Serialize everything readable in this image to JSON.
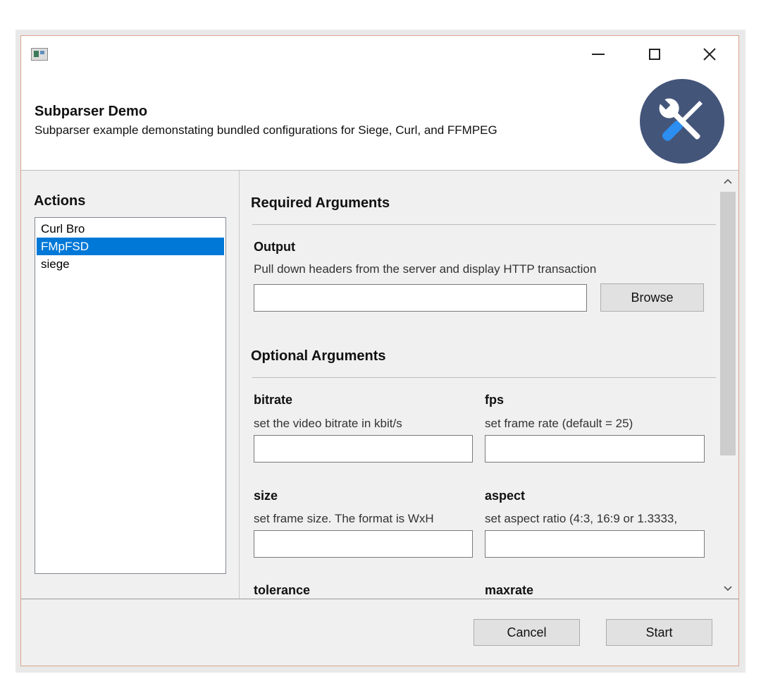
{
  "window": {
    "controls": {
      "minimize_icon": "minimize-icon",
      "maximize_icon": "maximize-icon",
      "close_icon": "close-icon"
    }
  },
  "header": {
    "title": "Subparser Demo",
    "description": "Subparser example demonstating bundled configurations for Siege, Curl, and FFMPEG",
    "logo_icon": "tools-icon",
    "logo_color": "#44557a"
  },
  "actions": {
    "title": "Actions",
    "items": [
      {
        "label": "Curl Bro",
        "selected": false
      },
      {
        "label": "FMpFSD",
        "selected": true
      },
      {
        "label": "siege",
        "selected": false
      }
    ],
    "selection_color": "#0078d7"
  },
  "required": {
    "title": "Required Arguments",
    "output": {
      "label": "Output",
      "help": "Pull down headers from the server and display HTTP transaction",
      "value": "",
      "browse_label": "Browse"
    }
  },
  "optional": {
    "title": "Optional Arguments",
    "fields": [
      {
        "label": "bitrate",
        "help": "set the video bitrate in kbit/s",
        "value": ""
      },
      {
        "label": "fps",
        "help": "set frame rate (default = 25)",
        "value": ""
      },
      {
        "label": "size",
        "help": "set frame size. The format is WxH",
        "value": ""
      },
      {
        "label": "aspect",
        "help": "set aspect ratio (4:3, 16:9 or 1.3333,",
        "value": ""
      },
      {
        "label": "tolerance",
        "help": "",
        "value": ""
      },
      {
        "label": "maxrate",
        "help": "",
        "value": ""
      }
    ]
  },
  "footer": {
    "cancel_label": "Cancel",
    "start_label": "Start"
  }
}
